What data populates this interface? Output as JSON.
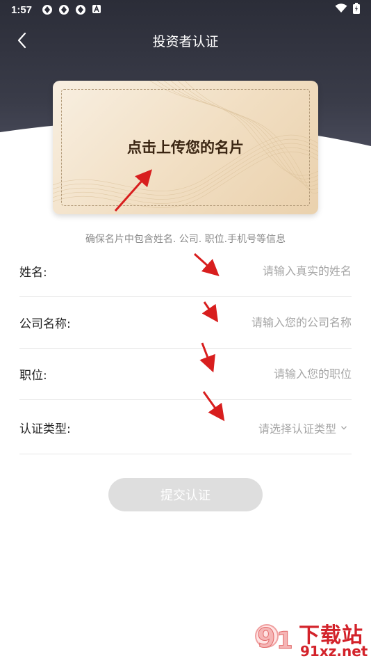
{
  "status_bar": {
    "time": "1:57"
  },
  "nav": {
    "title": "投资者认证"
  },
  "card": {
    "upload_text": "点击上传您的名片"
  },
  "hint": "确保名片中包含姓名. 公司. 职位.手机号等信息",
  "form": {
    "name": {
      "label": "姓名:",
      "placeholder": "请输入真实的姓名"
    },
    "company": {
      "label": "公司名称:",
      "placeholder": "请输入您的公司名称"
    },
    "position": {
      "label": "职位:",
      "placeholder": "请输入您的职位"
    },
    "type": {
      "label": "认证类型:",
      "placeholder": "请选择认证类型"
    }
  },
  "submit_label": "提交认证",
  "watermark": {
    "cn": "下载站",
    "url": "91xz.net",
    "logo_text": "91"
  },
  "colors": {
    "header": "#2b2d38",
    "annotation_arrow": "#d81e1e",
    "watermark": "#d3222a",
    "card": "#f1dec2"
  }
}
